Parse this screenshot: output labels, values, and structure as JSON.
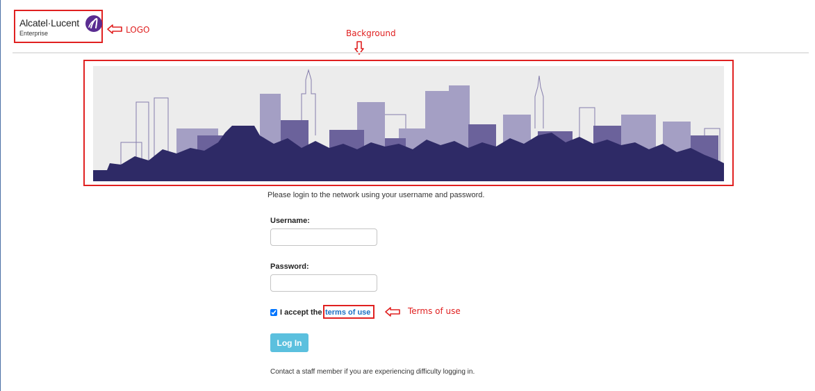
{
  "logo": {
    "name": "Alcatel·Lucent",
    "subtitle": "Enterprise"
  },
  "annotations": {
    "logo": "LOGO",
    "background": "Background",
    "terms": "Terms of use"
  },
  "banner": {
    "description": "city skyline",
    "colors": {
      "dark": "#2e2a66",
      "mid": "#6b629b",
      "light": "#a49fc4",
      "sky": "#ececec"
    }
  },
  "form": {
    "intro": "Please login to the network using your username and password.",
    "username_label": "Username:",
    "username_value": "",
    "password_label": "Password:",
    "password_value": "",
    "accept_text": "I accept the",
    "accept_checked": true,
    "terms_link": "terms of use",
    "login_button": "Log In",
    "contact_text": "Contact a staff member if you are experiencing difficulty logging in."
  },
  "colors": {
    "annotation": "#e02020",
    "button": "#5bc0de",
    "link": "#1a6fc4"
  }
}
